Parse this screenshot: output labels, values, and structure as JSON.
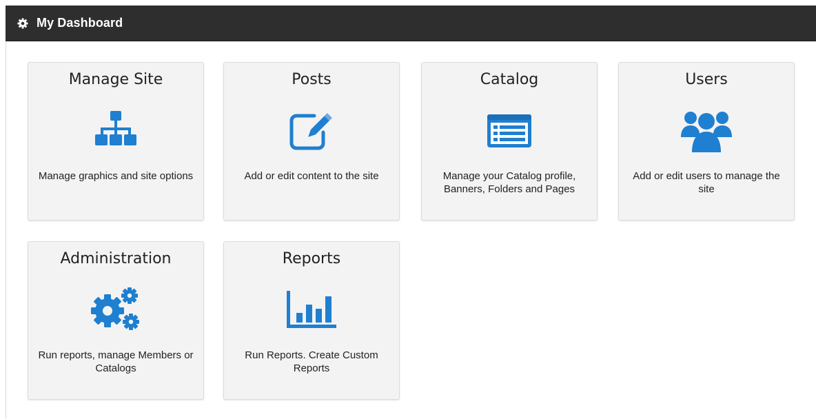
{
  "header": {
    "title": "My Dashboard",
    "icon": "gear-icon"
  },
  "colors": {
    "accent": "#1f7fd0",
    "header_bg": "#2e2e2e",
    "tile_bg": "#f3f3f3"
  },
  "tiles": [
    {
      "title": "Manage Site",
      "icon": "sitemap-icon",
      "description": "Manage graphics and site options"
    },
    {
      "title": "Posts",
      "icon": "edit-icon",
      "description": "Add or edit content to the site"
    },
    {
      "title": "Catalog",
      "icon": "catalog-list-icon",
      "description": "Manage your Catalog profile, Banners, Folders and Pages"
    },
    {
      "title": "Users",
      "icon": "users-icon",
      "description": "Add or edit users to manage the site"
    },
    {
      "title": "Administration",
      "icon": "gears-icon",
      "description": "Run reports, manage Members or Catalogs"
    },
    {
      "title": "Reports",
      "icon": "bar-chart-icon",
      "description": "Run Reports. Create Custom Reports"
    }
  ]
}
